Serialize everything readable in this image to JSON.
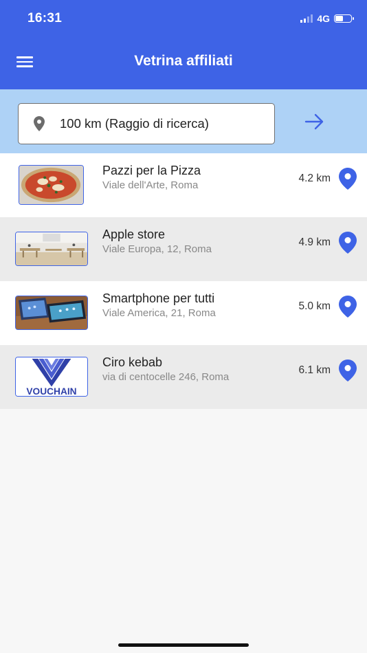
{
  "status_bar": {
    "time": "16:31",
    "network": "4G"
  },
  "header": {
    "title": "Vetrina affiliati",
    "menu_icon": "hamburger-menu-icon"
  },
  "search": {
    "value": "100 km (Raggio di ricerca)",
    "pin_icon": "location-pin-icon",
    "go_icon": "arrow-right-icon"
  },
  "accent_color": "#3e63e6",
  "stores": [
    {
      "name": "Pazzi per la Pizza",
      "address": "Viale dell'Arte, Roma",
      "distance": "4.2 km",
      "image": "pizza-photo"
    },
    {
      "name": "Apple store",
      "address": "Viale Europa, 12, Roma",
      "distance": "4.9 km",
      "image": "apple-store-photo"
    },
    {
      "name": "Smartphone per tutti",
      "address": "Viale America, 21, Roma",
      "distance": "5.0 km",
      "image": "smartphones-photo"
    },
    {
      "name": "Ciro kebab",
      "address": "via di centocelle 246, Roma",
      "distance": "6.1 km",
      "image": "vouchain-logo",
      "logo_text": "VOUCHAIN"
    }
  ]
}
